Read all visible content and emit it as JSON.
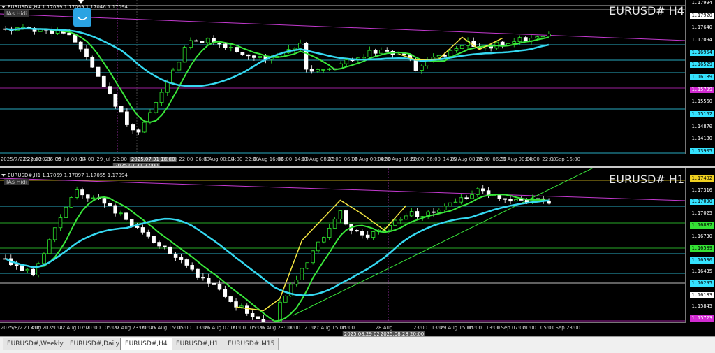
{
  "window": {
    "title": "MetaTrader charts"
  },
  "charts": [
    {
      "id": "h4",
      "header": "EURUSD#,H4  1.17099 1.17099 1.17046 1.17094",
      "indicator_label": "IAs Hidi",
      "symbol_title": "EURUSD# H4",
      "price_labels": [
        {
          "text": "1.17994",
          "color": "#ffffff",
          "bg": "#000000"
        },
        {
          "text": "1.17920",
          "color": "#000000",
          "bg": "#ffffff"
        },
        {
          "text": "1.17640",
          "color": "#ffffff",
          "bg": "#000000"
        },
        {
          "text": "1.17094",
          "color": "#ffffff",
          "bg": "#000000"
        },
        {
          "text": "1.16954",
          "color": "#000000",
          "bg": "#35e3ff"
        },
        {
          "text": "1.16529",
          "color": "#000000",
          "bg": "#35e3ff"
        },
        {
          "text": "1.16189",
          "color": "#000000",
          "bg": "#35e3ff"
        },
        {
          "text": "1.15799",
          "color": "#ffffff",
          "bg": "#d12bd1"
        },
        {
          "text": "1.15560",
          "color": "#ffffff",
          "bg": "#000000"
        },
        {
          "text": "1.15162",
          "color": "#000000",
          "bg": "#35e3ff"
        },
        {
          "text": "1.14870",
          "color": "#ffffff",
          "bg": "#000000"
        },
        {
          "text": "1.14180",
          "color": "#ffffff",
          "bg": "#000000"
        },
        {
          "text": "1.13905",
          "color": "#000000",
          "bg": "#35e3ff"
        }
      ],
      "time_labels": [
        {
          "text": "2025/7/22 22:00",
          "hi": false
        },
        {
          "text": "22 Jul 2025",
          "hi": false
        },
        {
          "text": "06:00",
          "hi": false
        },
        {
          "text": "25 Jul 00:00",
          "hi": false
        },
        {
          "text": "14:00",
          "hi": false
        },
        {
          "text": "29 Jul",
          "hi": false
        },
        {
          "text": "22:00",
          "hi": false
        },
        {
          "text": "2025.07.31 22:00",
          "hi": true
        },
        {
          "text": "2025.07.31 16:00",
          "hi": true
        },
        {
          "text": "08:00",
          "hi": false
        },
        {
          "text": "22:00",
          "hi": false
        },
        {
          "text": "06:00",
          "hi": false
        },
        {
          "text": "6 Aug 00:00",
          "hi": false
        },
        {
          "text": "14:00",
          "hi": false
        },
        {
          "text": "22:00",
          "hi": false
        },
        {
          "text": "8 Aug 16:00",
          "hi": false
        },
        {
          "text": "06:00",
          "hi": false
        },
        {
          "text": "14:00",
          "hi": false
        },
        {
          "text": "13 Aug 08:00",
          "hi": false
        },
        {
          "text": "22:00",
          "hi": false
        },
        {
          "text": "06:00",
          "hi": false
        },
        {
          "text": "18 Aug 00:00",
          "hi": false
        },
        {
          "text": "14:00",
          "hi": false
        },
        {
          "text": "20 Aug 16:00",
          "hi": false
        },
        {
          "text": "22:00",
          "hi": false
        },
        {
          "text": "06:00",
          "hi": false
        },
        {
          "text": "14:00",
          "hi": false
        },
        {
          "text": "25 Aug 08:00",
          "hi": false
        },
        {
          "text": "22:00",
          "hi": false
        },
        {
          "text": "06:00",
          "hi": false
        },
        {
          "text": "28 Aug 00:00",
          "hi": false
        },
        {
          "text": "14:00",
          "hi": false
        },
        {
          "text": "22:00",
          "hi": false
        },
        {
          "text": "1 Sep 16:00",
          "hi": false
        }
      ]
    },
    {
      "id": "h1",
      "header": "EURUSD#,H1  1.17059 1.17097 1.17055 1.17094",
      "indicator_label": "IAs Hidi",
      "symbol_title": "EURUSD# H1",
      "price_labels": [
        {
          "text": "1.17402",
          "color": "#000000",
          "bg": "#f0d020"
        },
        {
          "text": "1.17310",
          "color": "#ffffff",
          "bg": "#000000"
        },
        {
          "text": "1.17090",
          "color": "#000000",
          "bg": "#35e3ff"
        },
        {
          "text": "1.17025",
          "color": "#ffffff",
          "bg": "#000000"
        },
        {
          "text": "1.16887",
          "color": "#000000",
          "bg": "#35e335"
        },
        {
          "text": "1.16730",
          "color": "#ffffff",
          "bg": "#000000"
        },
        {
          "text": "1.16589",
          "color": "#000000",
          "bg": "#35e335"
        },
        {
          "text": "1.16530",
          "color": "#000000",
          "bg": "#35e3ff"
        },
        {
          "text": "1.16435",
          "color": "#ffffff",
          "bg": "#000000"
        },
        {
          "text": "1.16295",
          "color": "#000000",
          "bg": "#35e3ff"
        },
        {
          "text": "1.16183",
          "color": "#000000",
          "bg": "#ffffff"
        },
        {
          "text": "1.15845",
          "color": "#ffffff",
          "bg": "#000000"
        },
        {
          "text": "1.15723",
          "color": "#ffffff",
          "bg": "#d12bd1"
        }
      ],
      "time_labels": [
        {
          "text": "2025/8/21 13:00",
          "hi": false
        },
        {
          "text": "21 Aug 2025",
          "hi": false
        },
        {
          "text": "21:00",
          "hi": false
        },
        {
          "text": "22 Aug 07:00",
          "hi": false
        },
        {
          "text": "21:00",
          "hi": false
        },
        {
          "text": "05:00",
          "hi": false
        },
        {
          "text": "22 Aug 23:00",
          "hi": false
        },
        {
          "text": "21:00",
          "hi": false
        },
        {
          "text": "25 Aug 15:00",
          "hi": false
        },
        {
          "text": "05:00",
          "hi": false
        },
        {
          "text": "13:00",
          "hi": false
        },
        {
          "text": "26 Aug 07:00",
          "hi": false
        },
        {
          "text": "21:00",
          "hi": false
        },
        {
          "text": "05:00",
          "hi": false
        },
        {
          "text": "26 Aug 23:00",
          "hi": false
        },
        {
          "text": "13:00",
          "hi": false
        },
        {
          "text": "21:00",
          "hi": false
        },
        {
          "text": "27 Aug 15:00",
          "hi": false
        },
        {
          "text": "05:00",
          "hi": false
        },
        {
          "text": "2025.08.29 02:00",
          "hi": true
        },
        {
          "text": "28 Aug",
          "hi": false
        },
        {
          "text": "2025.08.28 20:00",
          "hi": true
        },
        {
          "text": "23:00",
          "hi": false
        },
        {
          "text": "13:00",
          "hi": false
        },
        {
          "text": "29 Aug 15:00",
          "hi": false
        },
        {
          "text": "05:00",
          "hi": false
        },
        {
          "text": "13:00",
          "hi": false
        },
        {
          "text": "1 Sep 07:00",
          "hi": false
        },
        {
          "text": "21:00",
          "hi": false
        },
        {
          "text": "05:00",
          "hi": false
        },
        {
          "text": "1 Sep 23:00",
          "hi": false
        }
      ]
    }
  ],
  "tabs": [
    {
      "label": "EURUSD#,Weekly",
      "active": false
    },
    {
      "label": "EURUSD#,Daily",
      "active": false
    },
    {
      "label": "EURUSD#,H4",
      "active": true
    },
    {
      "label": "EURUSD#,H1",
      "active": false
    },
    {
      "label": "EURUSD#,M15",
      "active": false
    }
  ],
  "colors": {
    "background": "#000000",
    "bull_candle": "#2ee62e",
    "bear_candle": "#ffffff",
    "ma_fast": "#39e63a",
    "ma_slow": "#35d8f0",
    "trendline": "#c43ad0",
    "zigzag": "#f5e642"
  }
}
